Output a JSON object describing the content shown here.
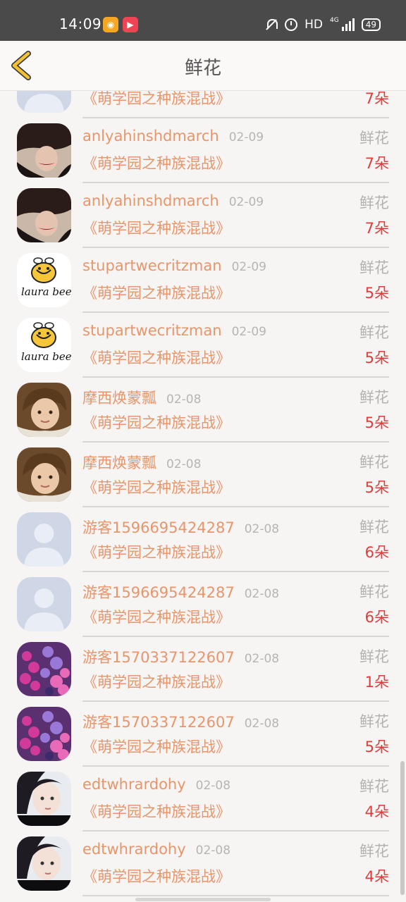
{
  "status_bar": {
    "time": "14:09",
    "network": "HD",
    "network_type": "4G",
    "battery": "49",
    "icons": [
      "weibo-app-icon",
      "video-app-icon",
      "bell-muted-icon",
      "alarm-clock-icon",
      "signal-icon",
      "battery-icon"
    ]
  },
  "header": {
    "title": "鲜花",
    "back_icon": "chevron-left-icon",
    "back_color": "#f2c230"
  },
  "colors": {
    "username": "#e8956a",
    "count": "#e33a3a",
    "muted": "#b5b1b1"
  },
  "rows": [
    {
      "user": "",
      "date": "",
      "type": "",
      "book": "《萌学园之种族混战》",
      "count": "7朵",
      "avatar": "default-avatar"
    },
    {
      "user": "anlyahinshdmarch",
      "date": "02-09",
      "type": "鲜花",
      "book": "《萌学园之种族混战》",
      "count": "7朵",
      "avatar": "woman-hat-avatar"
    },
    {
      "user": "anlyahinshdmarch",
      "date": "02-09",
      "type": "鲜花",
      "book": "《萌学园之种族混战》",
      "count": "7朵",
      "avatar": "woman-hat-avatar"
    },
    {
      "user": "stupartwecritzman",
      "date": "02-09",
      "type": "鲜花",
      "book": "《萌学园之种族混战》",
      "count": "5朵",
      "avatar": "laura-bee-avatar"
    },
    {
      "user": "stupartwecritzman",
      "date": "02-09",
      "type": "鲜花",
      "book": "《萌学园之种族混战》",
      "count": "5朵",
      "avatar": "laura-bee-avatar"
    },
    {
      "user": "摩西焕蒙瓢",
      "date": "02-08",
      "type": "鲜花",
      "book": "《萌学园之种族混战》",
      "count": "5朵",
      "avatar": "child-avatar"
    },
    {
      "user": "摩西焕蒙瓢",
      "date": "02-08",
      "type": "鲜花",
      "book": "《萌学园之种族混战》",
      "count": "5朵",
      "avatar": "child-avatar"
    },
    {
      "user": "游客1596695424287",
      "date": "02-08",
      "type": "鲜花",
      "book": "《萌学园之种族混战》",
      "count": "6朵",
      "avatar": "default-avatar"
    },
    {
      "user": "游客1596695424287",
      "date": "02-08",
      "type": "鲜花",
      "book": "《萌学园之种族混战》",
      "count": "6朵",
      "avatar": "default-avatar"
    },
    {
      "user": "游客1570337122607",
      "date": "02-08",
      "type": "鲜花",
      "book": "《萌学园之种族混战》",
      "count": "1朵",
      "avatar": "hyacinth-avatar"
    },
    {
      "user": "游客1570337122607",
      "date": "02-08",
      "type": "鲜花",
      "book": "《萌学园之种族混战》",
      "count": "5朵",
      "avatar": "hyacinth-avatar"
    },
    {
      "user": "edtwhrardohy",
      "date": "02-08",
      "type": "鲜花",
      "book": "《萌学园之种族混战》",
      "count": "4朵",
      "avatar": "girl-portrait-avatar"
    },
    {
      "user": "edtwhrardohy",
      "date": "02-08",
      "type": "鲜花",
      "book": "《萌学园之种族混战》",
      "count": "4朵",
      "avatar": "girl-portrait-avatar"
    }
  ]
}
